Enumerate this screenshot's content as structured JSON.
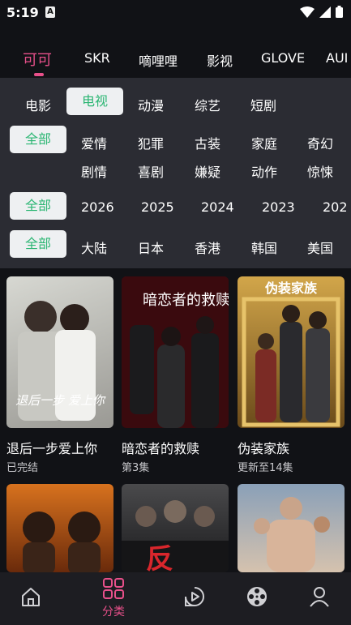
{
  "status_bar": {
    "time": "5:19",
    "notif_letter": "A"
  },
  "top_tabs": [
    "可可",
    "SKR",
    "嘀哩哩",
    "影视",
    "GLOVE",
    "AUI"
  ],
  "categories": {
    "items": [
      "电影",
      "电视",
      "动漫",
      "综艺",
      "短剧"
    ],
    "selected": "电视"
  },
  "genres": {
    "all": "全部",
    "row1": [
      "爱情",
      "犯罪",
      "古装",
      "家庭",
      "奇幻"
    ],
    "row2": [
      "剧情",
      "喜剧",
      "嫌疑",
      "动作",
      "惊悚"
    ]
  },
  "years": {
    "all": "全部",
    "items": [
      "2026",
      "2025",
      "2024",
      "2023",
      "202"
    ]
  },
  "regions": {
    "all": "全部",
    "items": [
      "大陆",
      "日本",
      "香港",
      "韩国",
      "美国"
    ]
  },
  "shows": [
    {
      "title": "退后一步爱上你",
      "status": "已完结",
      "poster_text": "退后一步 爱上你",
      "colors": [
        "#c9cbc4",
        "#8b8a86"
      ]
    },
    {
      "title": "暗恋者的救赎",
      "status": "第3集",
      "poster_text": "暗恋者的救赎",
      "colors": [
        "#4a0b10",
        "#120608"
      ]
    },
    {
      "title": "伪装家族",
      "status": "更新至14集",
      "poster_text": "伪装家族",
      "colors": [
        "#b88a2f",
        "#4c3312"
      ]
    },
    {
      "title": "",
      "status": "",
      "poster_text": "",
      "colors": [
        "#c96a1b",
        "#5a2209"
      ]
    },
    {
      "title": "",
      "status": "",
      "poster_text": "反",
      "colors": [
        "#3a3a3c",
        "#1a1a1c"
      ]
    },
    {
      "title": "",
      "status": "",
      "poster_text": "",
      "colors": [
        "#7a8ca0",
        "#c9b9a6"
      ]
    }
  ],
  "bottom_nav": {
    "category_label": "分类"
  },
  "colors": {
    "accent": "#e8508a",
    "selected_text": "#2bb673",
    "panel": "#2b2c33",
    "background": "#111216"
  }
}
